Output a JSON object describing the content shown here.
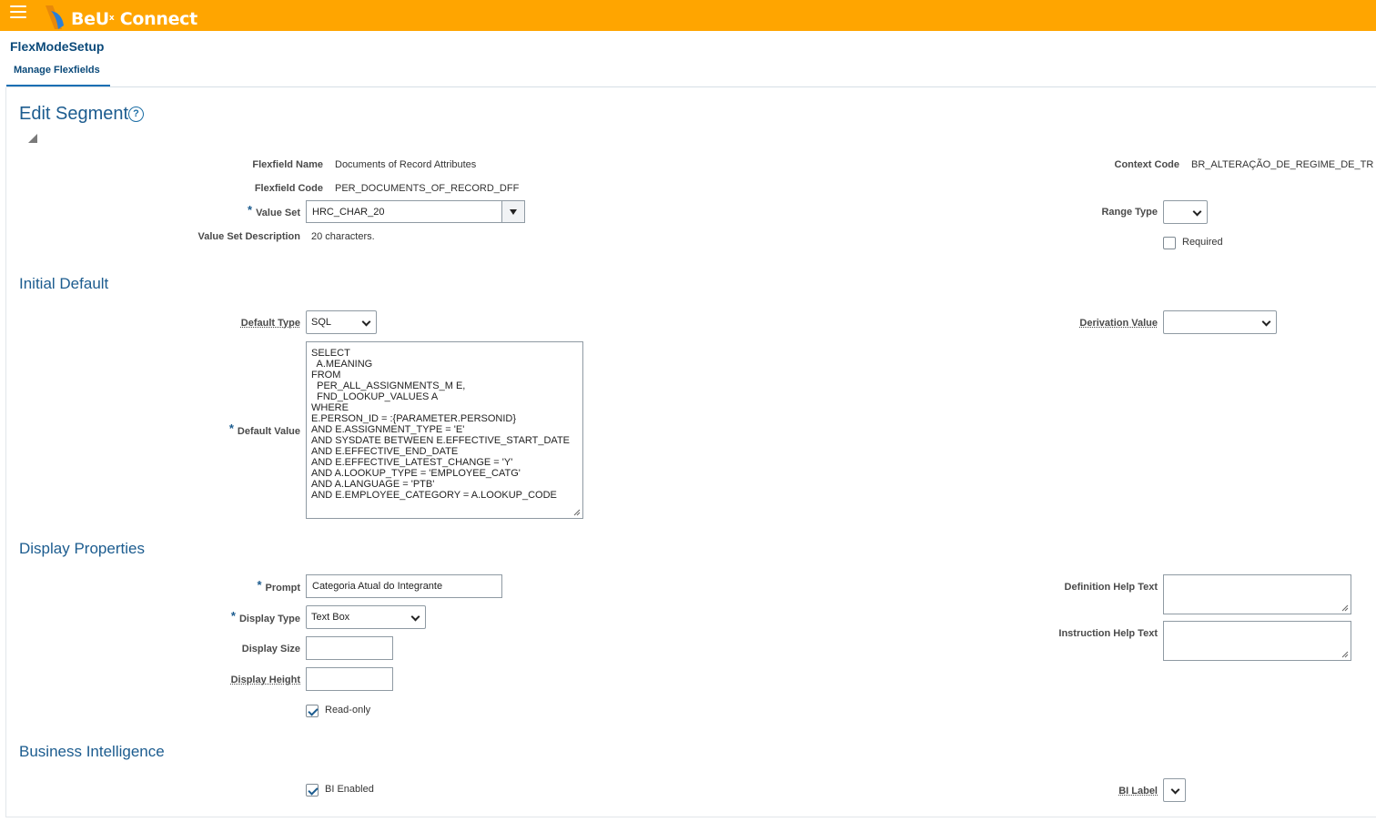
{
  "header": {
    "brand_main": "BeU",
    "brand_sup": "x",
    "brand_rest": " Connect",
    "app_title": "FlexModeSetup",
    "tab_label": "Manage Flexfields",
    "accent_color": "#ffa500"
  },
  "page": {
    "title": "Edit Segment",
    "help_glyph": "?"
  },
  "segment": {
    "flexfield_name_label": "Flexfield Name",
    "flexfield_name": "Documents of Record Attributes",
    "flexfield_code_label": "Flexfield Code",
    "flexfield_code": "PER_DOCUMENTS_OF_RECORD_DFF",
    "value_set_label": "Value Set",
    "value_set": "HRC_CHAR_20",
    "value_set_desc_label": "Value Set Description",
    "value_set_desc": "20 characters.",
    "context_code_label": "Context Code",
    "context_code": "BR_ALTERAÇÃO_DE_REGIME_DE_TR",
    "range_type_label": "Range Type",
    "range_type": "",
    "required_label": "Required",
    "required": false
  },
  "initial_default": {
    "heading": "Initial Default",
    "default_type_label": "Default Type",
    "default_type": "SQL",
    "derivation_value_label": "Derivation Value",
    "derivation_value": "",
    "default_value_label": "Default Value",
    "default_value": "SELECT\n  A.MEANING\nFROM\n  PER_ALL_ASSIGNMENTS_M E,\n  FND_LOOKUP_VALUES A\nWHERE\nE.PERSON_ID = :{PARAMETER.PERSONID}\nAND E.ASSIGNMENT_TYPE = 'E'\nAND SYSDATE BETWEEN E.EFFECTIVE_START_DATE\nAND E.EFFECTIVE_END_DATE\nAND E.EFFECTIVE_LATEST_CHANGE = 'Y'\nAND A.LOOKUP_TYPE = 'EMPLOYEE_CATG'\nAND A.LANGUAGE = 'PTB'\nAND E.EMPLOYEE_CATEGORY = A.LOOKUP_CODE"
  },
  "display_properties": {
    "heading": "Display Properties",
    "prompt_label": "Prompt",
    "prompt": "Categoria Atual do Integrante",
    "display_type_label": "Display Type",
    "display_type": "Text Box",
    "display_size_label": "Display Size",
    "display_size": "",
    "display_height_label": "Display Height",
    "display_height": "",
    "read_only_label": "Read-only",
    "read_only": true,
    "definition_help_label": "Definition Help Text",
    "definition_help": "",
    "instruction_help_label": "Instruction Help Text",
    "instruction_help": ""
  },
  "business_intelligence": {
    "heading": "Business Intelligence",
    "bi_enabled_label": "BI Enabled",
    "bi_enabled": true,
    "bi_label_label": "BI Label",
    "bi_label": ""
  }
}
